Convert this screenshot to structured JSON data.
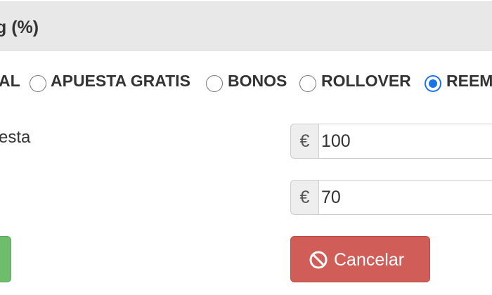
{
  "panel": {
    "title": "g (%)"
  },
  "bet_types": {
    "items": [
      {
        "label": "AL",
        "checked": false
      },
      {
        "label": "APUESTA GRATIS",
        "checked": false
      },
      {
        "label": "BONOS",
        "checked": false
      },
      {
        "label": "ROLLOVER",
        "checked": false
      },
      {
        "label": "REEM",
        "checked": true
      }
    ]
  },
  "form": {
    "stake_label": "esta",
    "currency_symbol": "€",
    "stake_value": "100",
    "second_value": "70"
  },
  "actions": {
    "cancel_label": "Cancelar"
  },
  "colors": {
    "accent": "#1a73e8",
    "danger": "#d05d57",
    "success": "#6dbd6d",
    "header_bg": "#e8e8e8"
  }
}
